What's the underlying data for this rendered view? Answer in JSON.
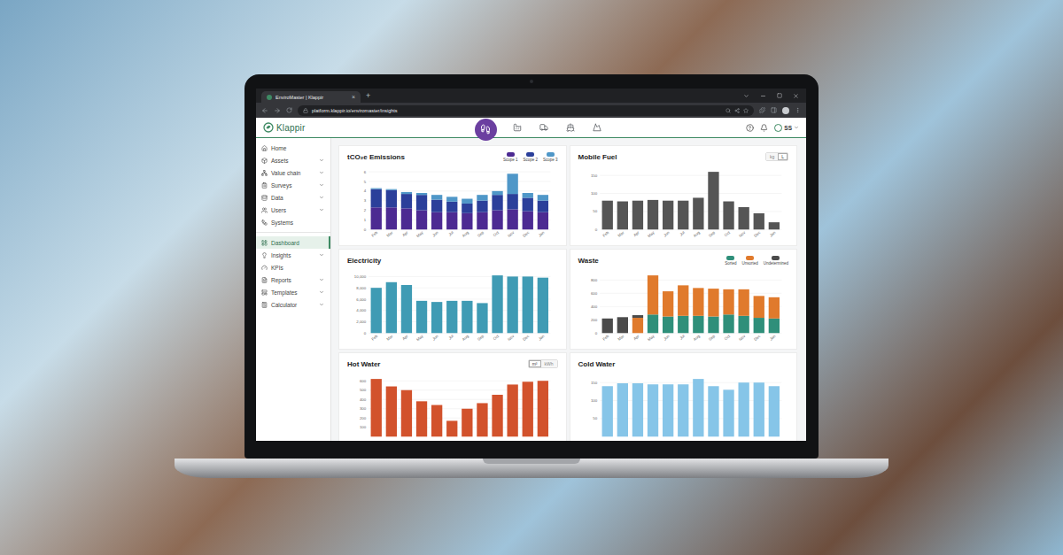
{
  "browser": {
    "tab_title": "EnviroMaster | Klappir",
    "tab_close": "×",
    "new_tab": "+",
    "url": "platform.klappir.io/enviromaster/insights"
  },
  "header": {
    "logo": "Klappir",
    "modules": [
      {
        "selected": true
      },
      {
        "selected": false
      },
      {
        "selected": false
      },
      {
        "selected": false
      },
      {
        "selected": false
      }
    ],
    "user": "SS"
  },
  "sidebar": {
    "groups": [
      [
        {
          "label": "Home",
          "selected": false,
          "expandable": false
        },
        {
          "label": "Assets",
          "selected": false,
          "expandable": true
        },
        {
          "label": "Value chain",
          "selected": false,
          "expandable": true
        },
        {
          "label": "Surveys",
          "selected": false,
          "expandable": true
        },
        {
          "label": "Data",
          "selected": false,
          "expandable": true
        },
        {
          "label": "Users",
          "selected": false,
          "expandable": true
        },
        {
          "label": "Systems",
          "selected": false,
          "expandable": false
        }
      ],
      [
        {
          "label": "Dashboard",
          "selected": true,
          "expandable": false
        },
        {
          "label": "Insights",
          "selected": false,
          "expandable": true
        },
        {
          "label": "KPIs",
          "selected": false,
          "expandable": false
        },
        {
          "label": "Reports",
          "selected": false,
          "expandable": true
        },
        {
          "label": "Templates",
          "selected": false,
          "expandable": true
        },
        {
          "label": "Calculator",
          "selected": false,
          "expandable": true
        }
      ]
    ]
  },
  "charts": [
    {
      "title": "tCO₂e Emissions",
      "units": [],
      "series": [
        {
          "label": "Scope 1",
          "color": "#4c2a92",
          "values": [
            2.3,
            2.3,
            2.2,
            2.0,
            1.8,
            1.8,
            1.7,
            1.8,
            2.0,
            2.1,
            1.9,
            1.8
          ]
        },
        {
          "label": "Scope 2",
          "color": "#2b3f9a",
          "values": [
            1.9,
            1.8,
            1.5,
            1.6,
            1.3,
            1.1,
            1.0,
            1.2,
            1.6,
            1.6,
            1.4,
            1.2
          ]
        },
        {
          "label": "Scope 3",
          "color": "#4f97c8",
          "values": [
            0.1,
            0.1,
            0.2,
            0.2,
            0.5,
            0.5,
            0.5,
            0.6,
            0.4,
            2.1,
            0.5,
            0.6
          ]
        }
      ],
      "ticks": [
        "0",
        "1",
        "2",
        "3",
        "4",
        "5",
        "6"
      ],
      "months": [
        "Feb",
        "Mar",
        "Apr",
        "May",
        "Jun",
        "Jul",
        "Aug",
        "Sep",
        "Oct",
        "Nov",
        "Dec",
        "Jan"
      ]
    },
    {
      "title": "Mobile Fuel",
      "units": [
        {
          "label": "kg",
          "selected": false
        },
        {
          "label": "L",
          "selected": true
        }
      ],
      "series": [
        {
          "label": "",
          "color": "#555555",
          "values": [
            80,
            78,
            80,
            82,
            80,
            80,
            88,
            160,
            78,
            62,
            45,
            20
          ]
        }
      ],
      "ticks": [
        "0",
        "50",
        "100",
        "150"
      ],
      "months": [
        "Feb",
        "Mar",
        "Apr",
        "May",
        "Jun",
        "Jul",
        "Aug",
        "Sep",
        "Oct",
        "Nov",
        "Dec",
        "Jan"
      ]
    },
    {
      "title": "Electricity",
      "units": [],
      "series": [
        {
          "label": "",
          "color": "#3f9bb4",
          "values": [
            8000,
            9000,
            8500,
            5700,
            5500,
            5700,
            5700,
            5300,
            10200,
            10000,
            10000,
            9800
          ]
        }
      ],
      "ticks": [
        "0",
        "2,000",
        "4,000",
        "6,000",
        "8,000",
        "10,000"
      ],
      "months": [
        "Feb",
        "Mar",
        "Apr",
        "May",
        "Jun",
        "Jul",
        "Aug",
        "Sep",
        "Oct",
        "Nov",
        "Dec",
        "Jan"
      ]
    },
    {
      "title": "Waste",
      "units": [],
      "series": [
        {
          "label": "Sorted",
          "color": "#2f8f7a",
          "values": [
            0,
            0,
            0,
            280,
            250,
            260,
            260,
            250,
            280,
            260,
            230,
            220
          ]
        },
        {
          "label": "Unsorted",
          "color": "#e07a2c",
          "values": [
            0,
            0,
            230,
            590,
            380,
            460,
            420,
            420,
            380,
            400,
            330,
            320
          ]
        },
        {
          "label": "Undetermined",
          "color": "#4b4b4b",
          "values": [
            220,
            240,
            40,
            0,
            0,
            0,
            0,
            0,
            0,
            0,
            0,
            0
          ]
        }
      ],
      "ticks": [
        "0",
        "200",
        "400",
        "600",
        "800"
      ],
      "months": [
        "Feb",
        "Mar",
        "Apr",
        "May",
        "Jun",
        "Jul",
        "Aug",
        "Sep",
        "Oct",
        "Nov",
        "Dec",
        "Jan"
      ]
    },
    {
      "title": "Hot Water",
      "units": [
        {
          "label": "m³",
          "selected": true
        },
        {
          "label": "kWh",
          "selected": false
        }
      ],
      "series": [
        {
          "label": "",
          "color": "#d2522c",
          "values": [
            620,
            540,
            500,
            380,
            340,
            170,
            300,
            360,
            450,
            560,
            590,
            600
          ]
        }
      ],
      "ticks": [
        "100",
        "200",
        "300",
        "400",
        "500",
        "600"
      ],
      "months": []
    },
    {
      "title": "Cold Water",
      "units": [],
      "series": [
        {
          "label": "",
          "color": "#86c5e8",
          "values": [
            140,
            148,
            148,
            145,
            145,
            145,
            160,
            140,
            130,
            150,
            150,
            140
          ]
        }
      ],
      "ticks": [
        "50",
        "100",
        "150"
      ],
      "months": []
    }
  ]
}
